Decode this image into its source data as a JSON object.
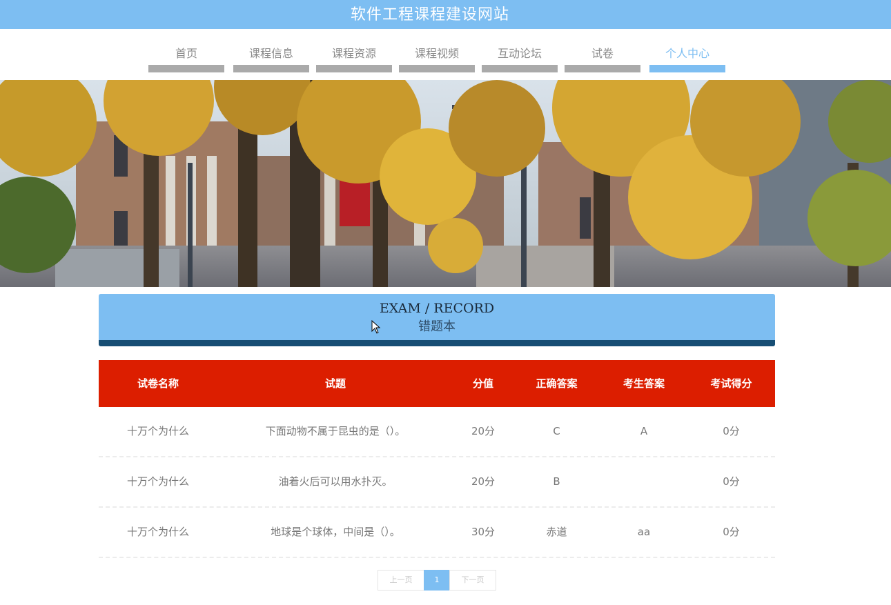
{
  "site": {
    "title": "软件工程课程建设网站"
  },
  "nav": {
    "items": [
      {
        "label": "首页"
      },
      {
        "label": "课程信息"
      },
      {
        "label": "课程资源"
      },
      {
        "label": "课程视频"
      },
      {
        "label": "互动论坛"
      },
      {
        "label": "试卷"
      },
      {
        "label": "个人中心"
      }
    ],
    "active_index": 6
  },
  "section": {
    "title_en": "EXAM / RECORD",
    "title_cn": "错题本"
  },
  "table": {
    "headers": [
      "试卷名称",
      "试题",
      "分值",
      "正确答案",
      "考生答案",
      "考试得分"
    ],
    "rows": [
      [
        "十万个为什么",
        "下面动物不属于昆虫的是（）。",
        "20分",
        "C",
        "A",
        "0分"
      ],
      [
        "十万个为什么",
        "油着火后可以用水扑灭。",
        "20分",
        "B",
        "",
        "0分"
      ],
      [
        "十万个为什么",
        "地球是个球体，中间是（）。",
        "30分",
        "赤道",
        "aa",
        "0分"
      ]
    ]
  },
  "pagination": {
    "prev": "上一页",
    "current": "1",
    "next": "下一页"
  },
  "colors": {
    "accent": "#7dbef2",
    "header_red": "#dc1e00",
    "dark_blue": "#174e74"
  }
}
